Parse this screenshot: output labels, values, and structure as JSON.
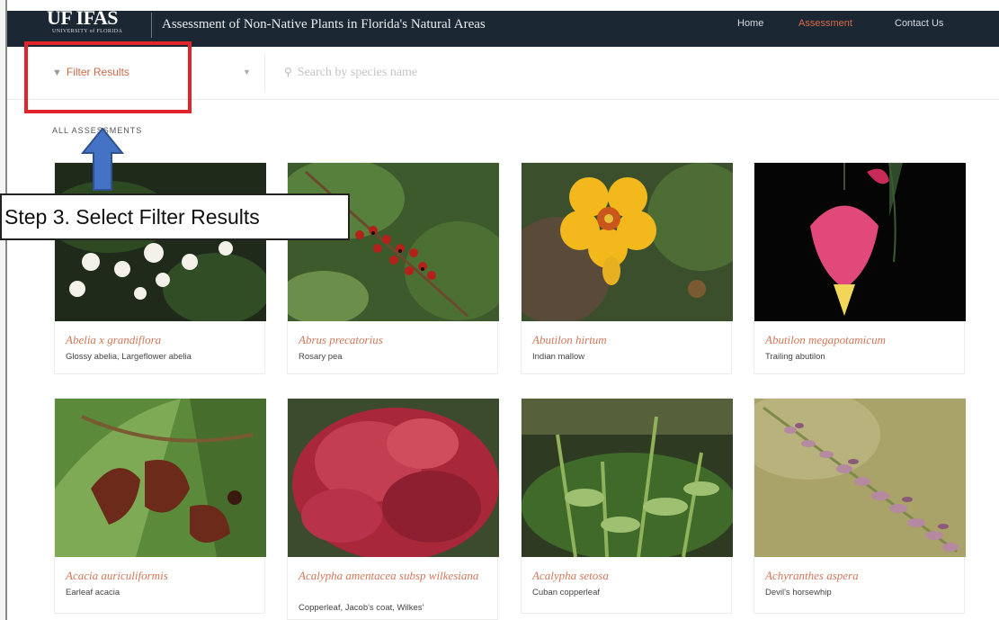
{
  "header": {
    "logo": "UF IFAS",
    "logo_sub": "UNIVERSITY of FLORIDA",
    "site_title": "Assessment of Non-Native Plants in Florida's Natural Areas",
    "nav": [
      {
        "label": "Home",
        "active": false
      },
      {
        "label": "Assessment",
        "active": true
      },
      {
        "label": "Contact Us",
        "active": false
      }
    ]
  },
  "filter": {
    "label": "Filter Results",
    "search_placeholder": "Search by species name"
  },
  "section_label": "ALL ASSESSMENTS",
  "annotation": {
    "callout": "Step 3. Select Filter Results"
  },
  "cards": [
    {
      "scientific": "Abelia x grandiflora",
      "common": "Glossy abelia, Largeflower abelia"
    },
    {
      "scientific": "Abrus precatorius",
      "common": "Rosary pea"
    },
    {
      "scientific": "Abutilon hirtum",
      "common": "Indian mallow"
    },
    {
      "scientific": "Abutilon megapotamicum",
      "common": "Trailing abutilon"
    },
    {
      "scientific": "Acacia auriculiformis",
      "common": "Earleaf acacia"
    },
    {
      "scientific": "Acalypha amentacea subsp wilkesiana",
      "common": "Copperleaf, Jacob's coat, Wilkes'"
    },
    {
      "scientific": "Acalypha setosa",
      "common": "Cuban copperleaf"
    },
    {
      "scientific": "Achyranthes aspera",
      "common": "Devil's horsewhip"
    }
  ],
  "colors": {
    "header_bg": "#1b2733",
    "accent": "#d96c4a",
    "annotation_red": "#e2232a",
    "annotation_arrow": "#4472c4"
  }
}
